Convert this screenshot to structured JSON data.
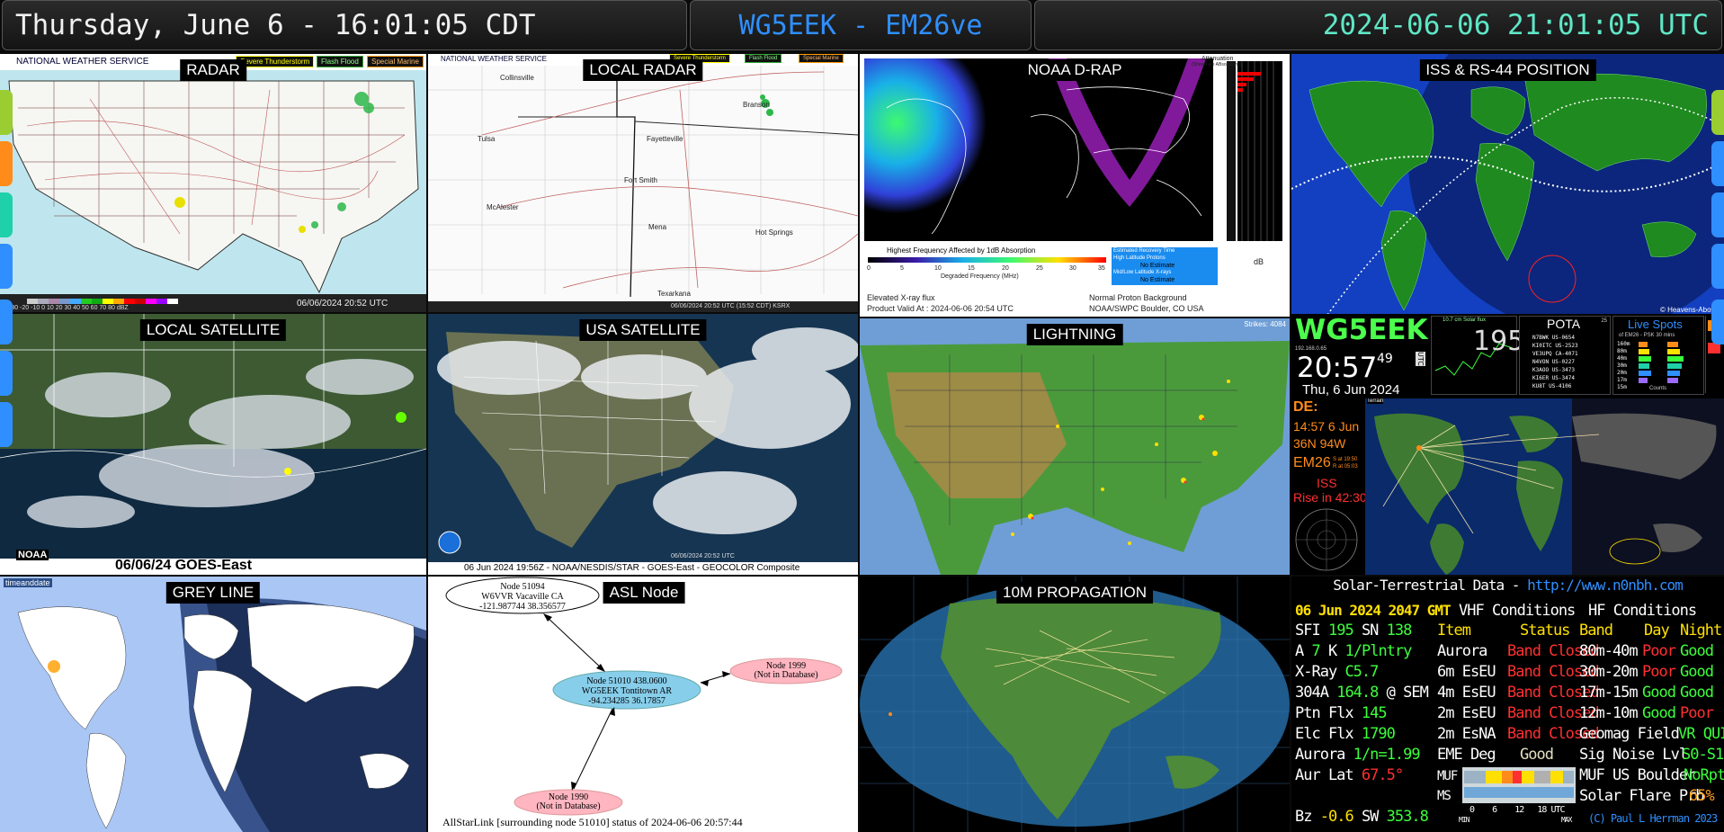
{
  "header": {
    "local_time": "Thursday, June 6 - 16:01:05 CDT",
    "callsign_grid": "WG5EEK - EM26ve",
    "utc_time": "2024-06-06 21:01:05 UTC"
  },
  "panels": {
    "radar": {
      "label": "RADAR",
      "provider": "NATIONAL WEATHER SERVICE",
      "legend": [
        "Severe Thunderstorm",
        "Flash Flood",
        "Special Marine"
      ],
      "timestamp": "06/06/2024 20:52 UTC",
      "scale": "-30 -20 -10 0 10 20 30 40 50 60 70 80 dBZ"
    },
    "local_radar": {
      "label": "LOCAL RADAR",
      "provider": "NATIONAL WEATHER SERVICE",
      "legend": [
        "Severe Thunderstorm",
        "Flash Flood",
        "Special Marine"
      ],
      "towns": [
        "Collinsville",
        "Branson",
        "Tulsa",
        "Fayetteville",
        "Fort Smith",
        "McAlester",
        "Mena",
        "Hot Springs",
        "Texarkana"
      ],
      "timestamp": "06/06/2024 20:52 UTC (15:52 CDT) KSRX"
    },
    "drap": {
      "label": "NOAA D-RAP",
      "atten_title": "Attenuation",
      "atten_sub": "(Shown are ABsorptions)",
      "bar_title": "Highest Frequency Affected by 1dB Absorption",
      "bar_ticks": [
        "0",
        "5",
        "10",
        "15",
        "20",
        "25",
        "30",
        "35"
      ],
      "bar_units": "Degraded Frequency (MHz)",
      "recovery": [
        "Estimated Recovery Time",
        "High Latitude Protons",
        "No Estimate",
        "Mid/Low Latitude X-rays",
        "No Estimate"
      ],
      "db_label": "dB",
      "foot_left_1": "Elevated X-ray flux",
      "foot_left_2": "Product Valid At : 2024-06-06 20:54 UTC",
      "foot_right_1": "Normal Proton Background",
      "foot_right_2": "NOAA/SWPC Boulder, CO USA"
    },
    "iss": {
      "label": "ISS & RS-44 POSITION",
      "credit": "© Heavens-Above"
    },
    "local_sat": {
      "label": "LOCAL SATELLITE",
      "caption": "06/06/24 GOES-East",
      "agency": "NOAA"
    },
    "usa_sat": {
      "label": "USA SATELLITE",
      "timestamp": "06/06/2024 20:52 UTC",
      "caption": "06 Jun 2024 19:56Z - NOAA/NESDIS/STAR - GOES-East - GEOCOLOR Composite"
    },
    "lightning": {
      "label": "LIGHTNING",
      "strikes": "Strikes: 4084"
    },
    "grey_line": {
      "label": "GREY LINE",
      "provider": "timeanddate"
    },
    "asl": {
      "label": "ASL Node",
      "nodes": [
        {
          "line1": "Node 51094",
          "line2": "W6VVR Vacaville CA",
          "line3": "-121.987744 38.356577"
        },
        {
          "line1": "Node 51010 438.0600",
          "line2": "WG5EEK Tontitown AR",
          "line3": "-94.234285 36.17857"
        },
        {
          "line1": "Node 1999",
          "line2": "(Not in Database)"
        },
        {
          "line1": "Node 1990",
          "line2": "(Not in Database)"
        }
      ],
      "footer": "AllStarLink [surrounding node 51010] status of 2024-06-06 20:57:44"
    },
    "prop10m": {
      "label": "10M PROPAGATION"
    },
    "clock": {
      "call": "WG5EEK",
      "ip": "192.168.0.65",
      "time": "20:57",
      "seconds": "49",
      "date": "Thu, 6 Jun 2024",
      "utc_badge": "UTC",
      "sfi_value": "195",
      "sfi_caption": "10.7 cm Solar flux",
      "pota_title": "POTA",
      "pota_count": "25",
      "pota": [
        {
          "call": "N7BWK",
          "ref": "US-0654"
        },
        {
          "call": "KI0ITC",
          "ref": "US-2523"
        },
        {
          "call": "VE3UPQ",
          "ref": "CA-4071"
        },
        {
          "call": "N4VON",
          "ref": "US-0227"
        },
        {
          "call": "K3AOO",
          "ref": "US-3473"
        },
        {
          "call": "KI6ER",
          "ref": "US-3474"
        },
        {
          "call": "KU8T",
          "ref": "US-4106"
        }
      ],
      "spots_title": "Live Spots",
      "spots_sub": "of EM26 - PSK 30 mins",
      "spots_bands": [
        "160m",
        "80m",
        "40m",
        "30m",
        "20m",
        "17m",
        "15m"
      ],
      "spots_foot": "Counts",
      "de_label": "DE:",
      "de_time": "14:57 6 Jun",
      "de_loc": "36N  94W",
      "de_grid": "EM26",
      "de_sun1": "S at 19:50",
      "de_sun2": "R at 05:03",
      "iss_label": "ISS",
      "iss_rise": "Rise in 42:30",
      "map_tag": "Terrain"
    },
    "solar": {
      "title": "Solar-Terrestrial Data - ",
      "url": "http://www.n0nbh.com",
      "date": "06 Jun 2024 2047 GMT",
      "vhf_title": "VHF Conditions",
      "hf_title": "HF Conditions",
      "vhf_cols": [
        "Item",
        "Status"
      ],
      "hf_cols": [
        "Band",
        "Day",
        "Night"
      ],
      "left_rows": [
        {
          "k": "SFI",
          "v": "195",
          "k2": "SN",
          "v2": "138"
        },
        {
          "k": "A",
          "v": "7",
          "k2": "K",
          "v2": "1/Plntry"
        },
        {
          "k": "X-Ray",
          "v": "C5.7"
        },
        {
          "k": "304A",
          "v": "164.8",
          "k2": "@ SEM"
        },
        {
          "k": "Ptn Flx",
          "v": "145"
        },
        {
          "k": "Elc Flx",
          "v": "1790"
        },
        {
          "k": "Aurora",
          "v": "1/n=1.99"
        },
        {
          "k": "Aur Lat",
          "v": "67.5°"
        },
        {
          "k": "Bz",
          "v": "-0.6",
          "k2": "SW",
          "v2": "353.8"
        }
      ],
      "vhf_rows": [
        {
          "item": "Aurora",
          "status": "Band Closed"
        },
        {
          "item": "6m EsEU",
          "status": "Band Closed"
        },
        {
          "item": "4m EsEU",
          "status": "Band Closed"
        },
        {
          "item": "2m EsEU",
          "status": "Band Closed"
        },
        {
          "item": "2m EsNA",
          "status": "Band Closed"
        }
      ],
      "eme": {
        "k": "EME Deg",
        "v": "Good"
      },
      "muf_label": "MUF",
      "ms_label": "MS",
      "muf_ticks": [
        "0",
        "6",
        "12",
        "18",
        "UTC"
      ],
      "muf_min": "MIN",
      "muf_max": "MAX",
      "hf_rows": [
        {
          "band": "80m-40m",
          "day": "Poor",
          "night": "Good"
        },
        {
          "band": "30m-20m",
          "day": "Poor",
          "night": "Good"
        },
        {
          "band": "17m-15m",
          "day": "Good",
          "night": "Good"
        },
        {
          "band": "12m-10m",
          "day": "Good",
          "night": "Poor"
        }
      ],
      "extra_rows": [
        {
          "k": "Geomag Field",
          "v": "VR QUIET"
        },
        {
          "k": "Sig Noise Lvl",
          "v": "S0-S1"
        },
        {
          "k": "MUF US Boulder",
          "v": "NoRpt"
        },
        {
          "k": "Solar Flare Prb",
          "v": "65%"
        }
      ],
      "copyright": "(C) Paul L Herrman 2023"
    }
  },
  "colors": {
    "header_local": "#f0f0f0",
    "header_call": "#2f8fff",
    "header_utc": "#5fe7c6",
    "good": "#3cff3c",
    "bad": "#ff3030",
    "accent_yellow": "#ffe000"
  }
}
